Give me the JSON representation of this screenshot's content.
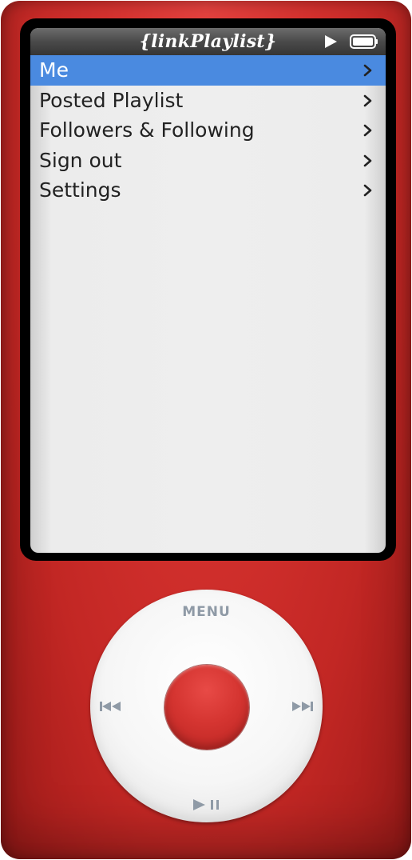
{
  "screen": {
    "title": "{linkPlaylist}",
    "status_icons": [
      "play-icon",
      "battery-icon"
    ],
    "menu": [
      {
        "label": "Me",
        "selected": true
      },
      {
        "label": "Posted Playlist",
        "selected": false
      },
      {
        "label": "Followers & Following",
        "selected": false
      },
      {
        "label": "Sign out",
        "selected": false
      },
      {
        "label": "Settings",
        "selected": false
      }
    ]
  },
  "wheel": {
    "menu_label": "MENU",
    "icons": [
      "previous-track-icon",
      "next-track-icon",
      "play-pause-icon"
    ]
  },
  "colors": {
    "device_body": "#d6322f",
    "selection_highlight": "#4a8ae0",
    "wheel_label": "#8f9aa6"
  }
}
